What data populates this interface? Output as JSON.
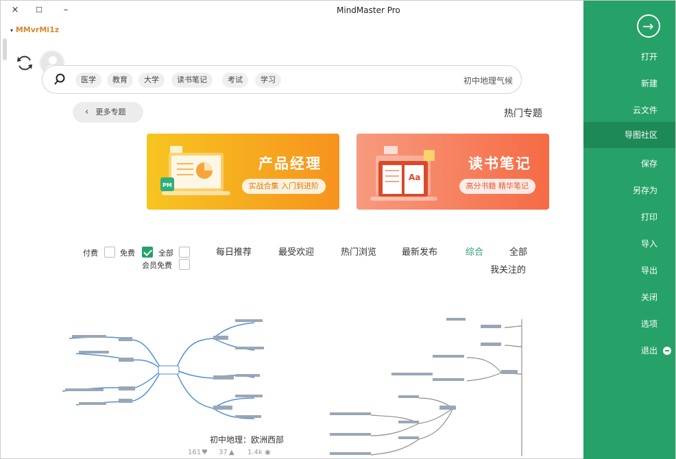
{
  "window": {
    "title": "MindMaster Pro",
    "brand": "MMvrMi1z",
    "close_glyph": "×",
    "maximize_glyph": "☐",
    "minimize_glyph": "–"
  },
  "sidebar": {
    "items": [
      {
        "label": "打开"
      },
      {
        "label": "新建"
      },
      {
        "label": "云文件"
      },
      {
        "label": "导图社区"
      },
      {
        "label": "保存"
      },
      {
        "label": "另存为"
      },
      {
        "label": "打印"
      },
      {
        "label": "导入"
      },
      {
        "label": "导出"
      },
      {
        "label": "关闭"
      },
      {
        "label": "选项"
      },
      {
        "label": "退出"
      }
    ],
    "active_index": 3,
    "accent": "#26a167"
  },
  "search": {
    "placeholder": "初中地理气候",
    "tags": [
      "学习",
      "考试",
      "读书笔记",
      "大学",
      "教育",
      "医学"
    ]
  },
  "hot": {
    "title": "热门专题",
    "more_label": "更多专题"
  },
  "banners": [
    {
      "title": "读书笔记",
      "subtitle": "高分书籍 精华笔记"
    },
    {
      "title": "产品经理",
      "subtitle": "实战合集 入门到进阶"
    }
  ],
  "filters": {
    "tabs": [
      "全部",
      "综合",
      "最新发布",
      "热门浏览",
      "最受欢迎",
      "每日推荐",
      "我关注的"
    ],
    "active_tab": "综合",
    "checks": [
      {
        "label": "全部",
        "checked": false
      },
      {
        "label": "免费",
        "checked": true
      },
      {
        "label": "付费",
        "checked": false
      },
      {
        "label": "会员免费",
        "checked": false
      }
    ]
  },
  "cards": [
    {
      "title": "初中地理：欧洲西部",
      "views": "1.4k",
      "likes": "37",
      "favorites": "161"
    }
  ]
}
